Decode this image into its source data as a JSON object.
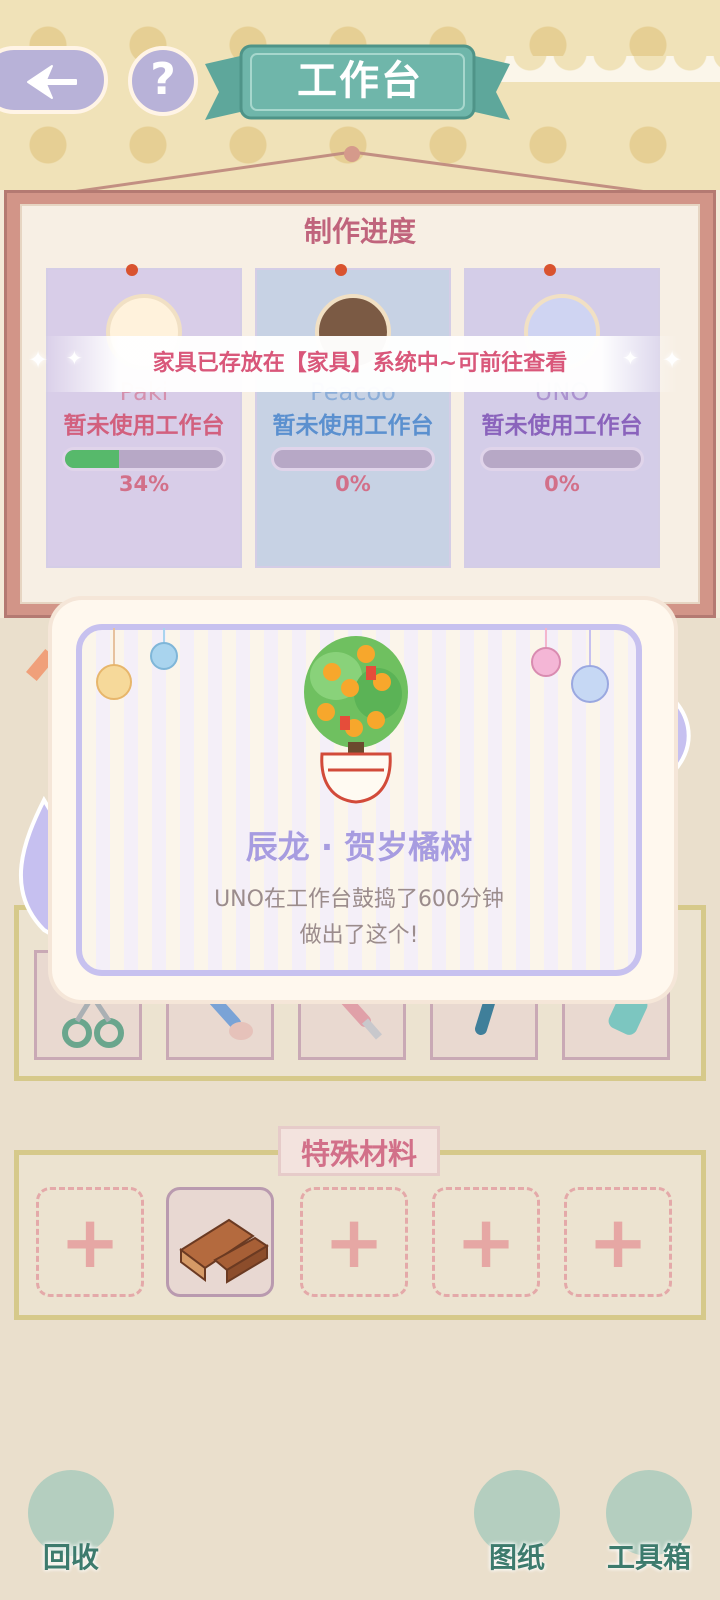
{
  "header": {
    "back_icon": "back-arrow-icon",
    "help_label": "?",
    "title": "工作台"
  },
  "progress_panel": {
    "title": "制作进度",
    "cards": [
      {
        "name": "Paki",
        "status": "暂未使用工作台",
        "percent": "34%",
        "progress": 0.34,
        "status_color": "#d2607e"
      },
      {
        "name": "Peacoo",
        "status": "暂未使用工作台",
        "percent": "0%",
        "progress": 0,
        "status_color": "#5b90cf"
      },
      {
        "name": "UNO",
        "status": "暂未使用工作台",
        "percent": "0%",
        "progress": 0,
        "status_color": "#8a63bc"
      }
    ]
  },
  "toast": {
    "message": "家具已存放在【家具】系统中~可前往查看"
  },
  "result_modal": {
    "item_name": "辰龙 · 贺岁橘树",
    "description_line1": "UNO在工作台鼓捣了600分钟",
    "description_line2": "做出了这个!"
  },
  "tools": [
    "scissors-icon",
    "brush-icon",
    "chisel-icon",
    "screwdriver-icon",
    "glue-bottle-icon"
  ],
  "special_materials": {
    "title": "特殊材料",
    "slots": [
      {
        "type": "add",
        "symbol": "+"
      },
      {
        "type": "item",
        "icon": "wood-planks-icon"
      },
      {
        "type": "add",
        "symbol": "+"
      },
      {
        "type": "add",
        "symbol": "+"
      },
      {
        "type": "add",
        "symbol": "+"
      }
    ]
  },
  "bottom_nav": {
    "recycle_label": "回收",
    "blueprint_label": "图纸",
    "toolbox_label": "工具箱"
  },
  "colors": {
    "accent_pink": "#d27089",
    "modal_border": "#c7c1ef",
    "progress_fill": "#57b96b"
  }
}
